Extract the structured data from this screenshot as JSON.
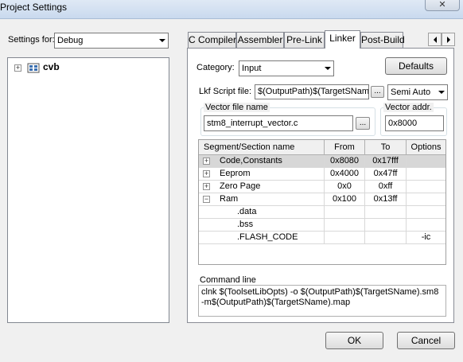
{
  "window": {
    "title": "Project Settings",
    "close_symbol": "✕"
  },
  "settings_for": {
    "label": "Settings for:",
    "value": "Debug"
  },
  "tree": {
    "root_label": "cvb",
    "expander": "+"
  },
  "tabs": {
    "items": [
      {
        "label": "C Compiler"
      },
      {
        "label": "Assembler"
      },
      {
        "label": "Pre-Link"
      },
      {
        "label": "Linker"
      },
      {
        "label": "Post-Build"
      }
    ],
    "active": "Linker"
  },
  "linker": {
    "category_label": "Category:",
    "category_value": "Input",
    "defaults_label": "Defaults",
    "lkf_label": "Lkf Script file:",
    "lkf_value": "$(OutputPath)$(TargetSName",
    "browse_label": "...",
    "mode_value": "Semi Auto",
    "vector_file": {
      "label": "Vector file name",
      "value": "stm8_interrupt_vector.c"
    },
    "vector_addr": {
      "label": "Vector addr.",
      "value": "0x8000"
    },
    "grid": {
      "columns": [
        "Segment/Section name",
        "From",
        "To",
        "Options"
      ],
      "rows": [
        {
          "expander": "+",
          "name": "Code,Constants",
          "from": "0x8080",
          "to": "0x17fff",
          "options": "",
          "selected": true
        },
        {
          "expander": "+",
          "name": "Eeprom",
          "from": "0x4000",
          "to": "0x47ff",
          "options": ""
        },
        {
          "expander": "+",
          "name": "Zero Page",
          "from": "0x0",
          "to": "0xff",
          "options": ""
        },
        {
          "expander": "−",
          "name": "Ram",
          "from": "0x100",
          "to": "0x13ff",
          "options": ""
        },
        {
          "expander": "",
          "name": ".data",
          "from": "",
          "to": "",
          "options": ""
        },
        {
          "expander": "",
          "name": ".bss",
          "from": "",
          "to": "",
          "options": ""
        },
        {
          "expander": "",
          "name": ".FLASH_CODE",
          "from": "",
          "to": "",
          "options": "-ic"
        }
      ]
    },
    "command_line": {
      "label": "Command line",
      "line1": "clnk $(ToolsetLibOpts) -o $(OutputPath)$(TargetSName).sm8",
      "line2": "-m$(OutputPath)$(TargetSName).map"
    }
  },
  "buttons": {
    "ok": "OK",
    "cancel": "Cancel"
  }
}
